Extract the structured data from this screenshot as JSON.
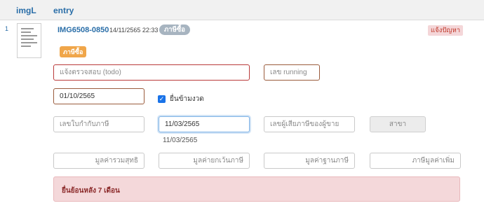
{
  "table": {
    "headers": {
      "imgl": "imgL",
      "entry": "entry"
    }
  },
  "row": {
    "number": "1",
    "doc_id": "IMG6508-0850",
    "date": "14/11/2565 22:33",
    "tag_grey": "ภาษีซื้อ",
    "report_button": "แจ้งปัญหา",
    "tag_orange": "ภาษีซื้อ"
  },
  "form": {
    "todo": {
      "placeholder": "แจ้งตรวจสอบ (todo)",
      "value": ""
    },
    "running": {
      "placeholder": "เลข running",
      "value": ""
    },
    "date": {
      "value": "01/10/2565"
    },
    "file_late": {
      "label": "ยื่นข้ามงวด",
      "checked": true
    },
    "invoice_no": {
      "placeholder": "เลขใบกำกับภาษี",
      "value": ""
    },
    "invoice_date": {
      "value": "11/03/2565"
    },
    "invoice_date_suggestion": "11/03/2565",
    "seller_tax_id": {
      "placeholder": "เลขผู้เสียภาษีของผู้ขาย",
      "value": ""
    },
    "branch": {
      "placeholder": "สาขา",
      "value": ""
    },
    "net_total": {
      "placeholder": "มูลค่ารวมสุทธิ",
      "value": ""
    },
    "exempt_value": {
      "placeholder": "มูลค่ายกเว้นภาษี",
      "value": ""
    },
    "tax_base": {
      "placeholder": "มูลค่าฐานภาษี",
      "value": ""
    },
    "vat": {
      "placeholder": "ภาษีมูลค่าเพิ่ม",
      "value": ""
    }
  },
  "alert": {
    "text": "ยื่นย้อนหลัง 7 เดือน"
  },
  "colors": {
    "link": "#2a6ea8",
    "tag_grey": "#a7b4c0",
    "tag_orange": "#f0a64a",
    "alert_bg": "#f4d8da",
    "alert_text": "#8b2a2a",
    "error_border": "#b93a3a",
    "focus_border": "#7fb3e6"
  }
}
